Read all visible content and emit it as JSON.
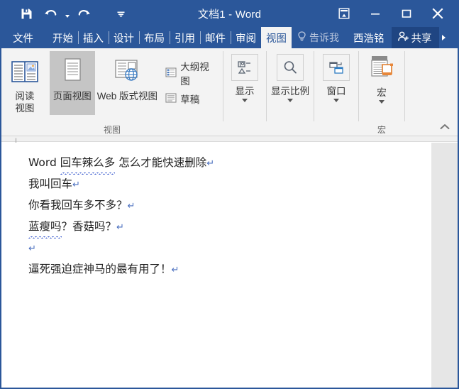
{
  "window": {
    "title": "文档1 - Word",
    "accent_color": "#2b579a",
    "ribbon_bg": "#f3f3f3"
  },
  "quick_access": {
    "save_label": "保存",
    "undo_label": "撤消",
    "undo_caret_label": "撤消下拉",
    "redo_label": "恢复",
    "customize_label": "自定义快速访问工具栏"
  },
  "window_controls": {
    "ribbon_display_label": "功能区显示选项",
    "minimize_label": "最小化",
    "maximize_label": "最大化",
    "close_label": "关闭"
  },
  "tabs": {
    "file": "文件",
    "items": [
      {
        "label": "开始",
        "active": false
      },
      {
        "label": "插入",
        "active": false
      },
      {
        "label": "设计",
        "active": false
      },
      {
        "label": "布局",
        "active": false
      },
      {
        "label": "引用",
        "active": false
      },
      {
        "label": "邮件",
        "active": false
      },
      {
        "label": "审阅",
        "active": false
      },
      {
        "label": "视图",
        "active": true
      }
    ],
    "tell_me": "告诉我",
    "user_name": "西浩铭",
    "share": "共享",
    "more_label": "更多"
  },
  "ribbon": {
    "views_group": {
      "label": "视图",
      "buttons": [
        {
          "label": "阅读\n视图",
          "label_line1": "阅读",
          "label_line2": "视图",
          "icon": "read-mode-icon",
          "selected": false
        },
        {
          "label": "页面视图",
          "icon": "print-layout-icon",
          "selected": true
        },
        {
          "label": "Web 版式视图",
          "icon": "web-layout-icon",
          "selected": false
        }
      ],
      "small_buttons": [
        {
          "label": "大纲视图",
          "icon": "outline-view-icon"
        },
        {
          "label": "草稿",
          "icon": "draft-view-icon"
        }
      ]
    },
    "show_group": {
      "label": "显示",
      "caret": true,
      "icon": "show-panels-icon"
    },
    "zoom_group": {
      "label": "显示比例",
      "caret": true,
      "icon": "magnifier-icon"
    },
    "window_group": {
      "label": "窗口",
      "caret": true,
      "icon": "windows-arrange-icon"
    },
    "macro_group": {
      "label": "宏",
      "group_label": "宏",
      "caret": true,
      "icon": "macro-scroll-icon"
    },
    "collapse_label": "折叠功能区"
  },
  "document": {
    "lines": [
      {
        "segments": [
          {
            "text": "Word ",
            "squiggly": false
          },
          {
            "text": "回车辣么多",
            "squiggly": true
          },
          {
            "text": " 怎么才能快速删除",
            "squiggly": false
          }
        ],
        "pilcrow": "↵"
      },
      {
        "segments": [
          {
            "text": "我叫回车",
            "squiggly": false
          }
        ],
        "pilcrow": "↵"
      },
      {
        "segments": [
          {
            "text": "你看我回车多不多？",
            "squiggly": false
          }
        ],
        "pilcrow": "↵"
      },
      {
        "segments": [
          {
            "text": "蓝瘦吗",
            "squiggly": true
          },
          {
            "text": "？香菇吗？",
            "squiggly": false
          }
        ],
        "pilcrow": "↵"
      },
      {
        "segments": [
          {
            "text": "",
            "squiggly": false
          }
        ],
        "pilcrow": "↵"
      },
      {
        "segments": [
          {
            "text": "逼死强迫症神马的最有用了！",
            "squiggly": false
          }
        ],
        "pilcrow": "↵"
      }
    ]
  }
}
